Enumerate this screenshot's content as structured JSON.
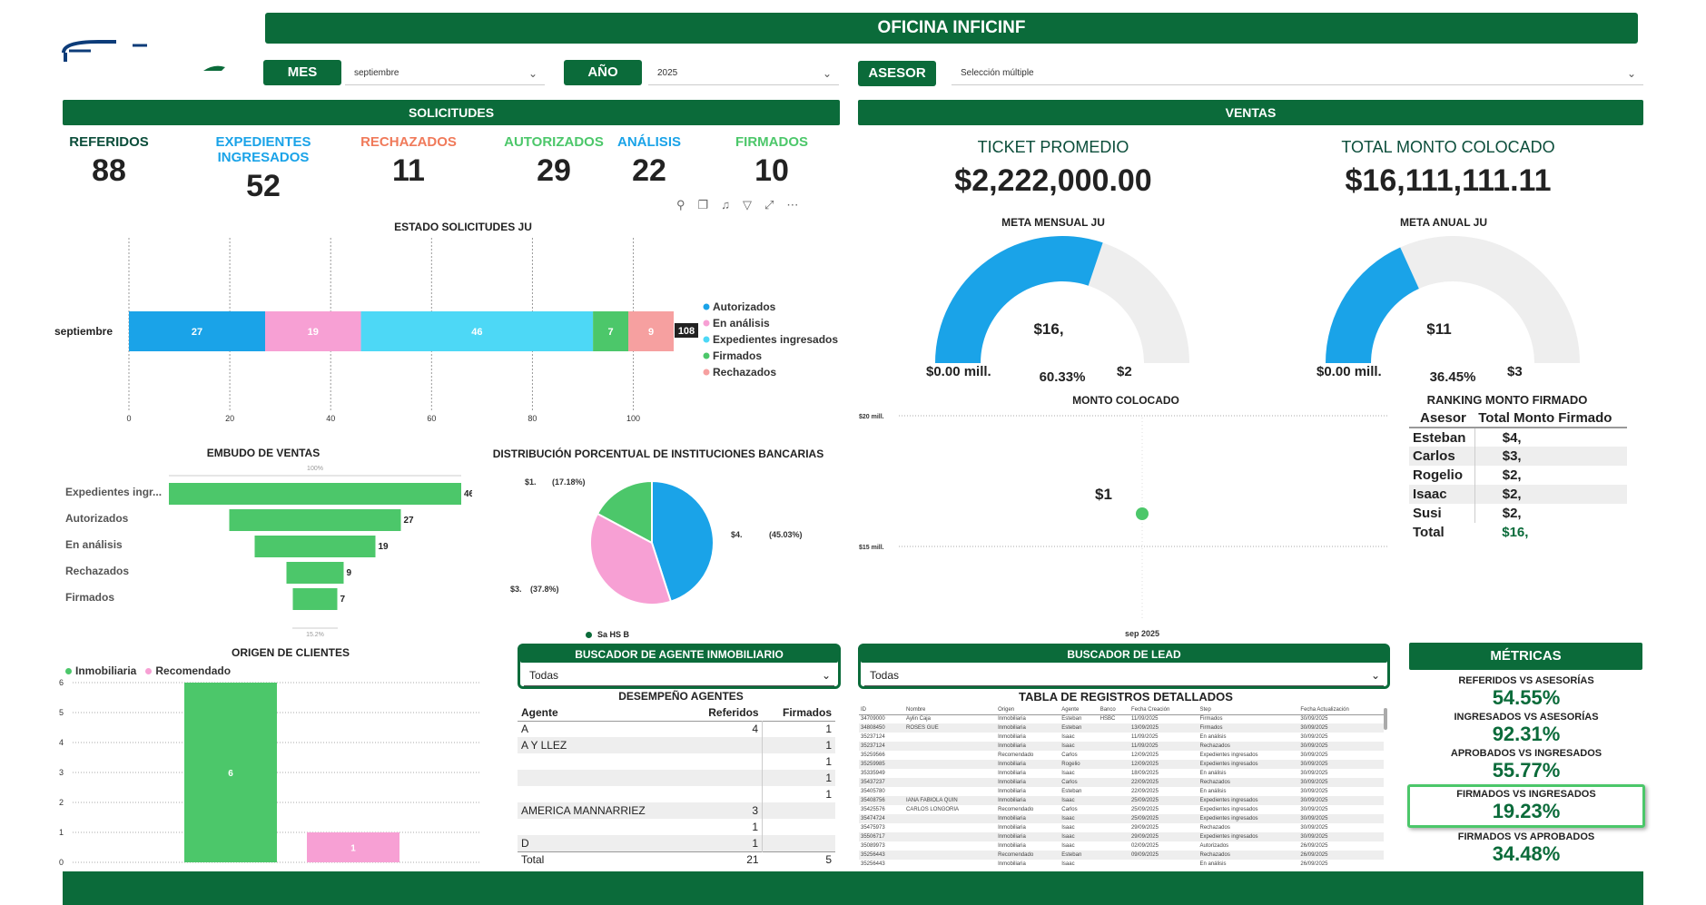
{
  "header": {
    "title": "OFICINA INFICINF"
  },
  "filters": {
    "mes_label": "MES",
    "mes_value": "septiembre",
    "anio_label": "AÑO",
    "anio_value": "2025",
    "asesor_label": "ASESOR",
    "asesor_value": "Selección múltiple"
  },
  "solicitudes": {
    "title": "SOLICITUDES",
    "kpis": [
      {
        "label": "REFERIDOS",
        "value": "88",
        "color": "#0b4d3a"
      },
      {
        "label": "EXPEDIENTES INGRESADOS",
        "value": "52",
        "color": "#1aa3e8"
      },
      {
        "label": "RECHAZADOS",
        "value": "11",
        "color": "#f07a5a"
      },
      {
        "label": "AUTORIZADOS",
        "value": "29",
        "color": "#4cc76a"
      },
      {
        "label": "ANÁLISIS",
        "value": "22",
        "color": "#1aa3e8"
      },
      {
        "label": "FIRMADOS",
        "value": "10",
        "color": "#4cc76a"
      }
    ]
  },
  "estado_chart": {
    "title": "ESTADO SOLICITUDES JU",
    "category": "septiembre",
    "total_label": "108",
    "legend": [
      "Autorizados",
      "En análisis",
      "Expedientes ingresados",
      "Firmados",
      "Rechazados"
    ]
  },
  "embudo": {
    "title": "EMBUDO DE VENTAS",
    "top_pct": "100%",
    "bottom_pct": "15.2%"
  },
  "distribucion": {
    "title": "DISTRIBUCIÓN PORCENTUAL DE INSTITUCIONES BANCARIAS",
    "legend_text": "Sa   HS   B"
  },
  "origen": {
    "title": "ORIGEN DE CLIENTES",
    "legend": [
      "Inmobiliaria",
      "Recomendado"
    ]
  },
  "buscador_agente": {
    "title": "BUSCADOR DE AGENTE INMOBILIARIO",
    "value": "Todas"
  },
  "desempeno": {
    "title": "DESEMPEÑO AGENTES",
    "headers": [
      "Agente",
      "Referidos",
      "Firmados"
    ],
    "rows": [
      {
        "agente": "A",
        "referidos": "4",
        "firmados": "1"
      },
      {
        "agente": "A  Y  LLEZ",
        "referidos": "",
        "firmados": "1"
      },
      {
        "agente": "",
        "referidos": "",
        "firmados": "1"
      },
      {
        "agente": "",
        "referidos": "",
        "firmados": "1"
      },
      {
        "agente": "",
        "referidos": "",
        "firmados": "1"
      },
      {
        "agente": "AMERICA MANNARRIEZ",
        "referidos": "3",
        "firmados": ""
      },
      {
        "agente": "",
        "referidos": "1",
        "firmados": ""
      },
      {
        "agente": "D",
        "referidos": "1",
        "firmados": ""
      }
    ],
    "total": {
      "agente": "Total",
      "referidos": "21",
      "firmados": "5"
    }
  },
  "ventas": {
    "title": "VENTAS",
    "ticket_label": "TICKET PROMEDIO",
    "ticket_value": "$2,222,000.00",
    "total_label": "TOTAL MONTO COLOCADO",
    "total_value": "$16,111,111.11",
    "meta_mensual": {
      "title": "META MENSUAL JU",
      "center": "$16,",
      "min": "$0.00 mill.",
      "pct": "60.33%",
      "max": "$2"
    },
    "meta_anual": {
      "title": "META ANUAL JU",
      "center": "$11",
      "min": "$0.00 mill.",
      "pct": "36.45%",
      "max": "$3"
    }
  },
  "monto_colocado": {
    "title": "MONTO COLOCADO",
    "y_top": "$20 mill.",
    "y_bottom": "$15 mill.",
    "point_label": "$1",
    "x_label": "sep 2025"
  },
  "ranking": {
    "title": "RANKING MONTO FIRMADO",
    "headers": [
      "Asesor",
      "Total Monto Firmado"
    ],
    "rows": [
      {
        "asesor": "Esteban",
        "monto": "$4,"
      },
      {
        "asesor": "Carlos",
        "monto": "$3,"
      },
      {
        "asesor": "Rogelio",
        "monto": "$2,"
      },
      {
        "asesor": "Isaac",
        "monto": "$2,"
      },
      {
        "asesor": "Susi",
        "monto": "$2,"
      }
    ],
    "total": {
      "asesor": "Total",
      "monto": "$16,"
    }
  },
  "buscador_lead": {
    "title": "BUSCADOR DE LEAD",
    "value": "Todas"
  },
  "tabla_registros": {
    "title": "TABLA DE REGISTROS DETALLADOS",
    "headers": [
      "ID",
      "Nombre",
      "Origen",
      "Agente",
      "Banco",
      "Fecha Creación",
      "Step",
      "Fecha Actualización"
    ],
    "rows": [
      [
        "34709000",
        "Aylin Caja",
        "Inmobiliaria",
        "Esteban",
        "HSBC",
        "11/09/2025",
        "Firmados",
        "30/09/2025"
      ],
      [
        "34808450",
        "ROSES GUE",
        "Inmobiliaria",
        "Esteban",
        "",
        "13/09/2025",
        "Firmados",
        "30/09/2025"
      ],
      [
        "35237124",
        "",
        "Inmobiliaria",
        "Isaac",
        "",
        "11/09/2025",
        "En análisis",
        "30/09/2025"
      ],
      [
        "35237124",
        "",
        "Inmobiliaria",
        "Isaac",
        "",
        "11/09/2025",
        "Rechazados",
        "30/09/2025"
      ],
      [
        "35259566",
        "",
        "Recomendado",
        "Carlos",
        "",
        "12/09/2025",
        "Expedientes ingresados",
        "30/09/2025"
      ],
      [
        "35259985",
        "",
        "Inmobiliaria",
        "Rogelio",
        "",
        "12/09/2025",
        "Expedientes ingresados",
        "30/09/2025"
      ],
      [
        "35335949",
        "",
        "Inmobiliaria",
        "Isaac",
        "",
        "18/09/2025",
        "En análisis",
        "30/09/2025"
      ],
      [
        "35437237",
        "",
        "Inmobiliaria",
        "Carlos",
        "",
        "22/09/2025",
        "Rechazados",
        "30/09/2025"
      ],
      [
        "35405780",
        "",
        "Inmobiliaria",
        "Esteban",
        "",
        "22/09/2025",
        "En análisis",
        "30/09/2025"
      ],
      [
        "35408756",
        "IANA FABIOLA QUIN",
        "Inmobiliaria",
        "Isaac",
        "",
        "25/09/2025",
        "Expedientes ingresados",
        "30/09/2025"
      ],
      [
        "35425576",
        "CARLOS LONGORIA",
        "Recomendado",
        "Carlos",
        "",
        "25/09/2025",
        "Expedientes ingresados",
        "30/09/2025"
      ],
      [
        "35474724",
        "",
        "Inmobiliaria",
        "Isaac",
        "",
        "25/09/2025",
        "Expedientes ingresados",
        "30/09/2025"
      ],
      [
        "35475973",
        "",
        "Inmobiliaria",
        "Isaac",
        "",
        "29/09/2025",
        "Rechazados",
        "30/09/2025"
      ],
      [
        "35506717",
        "",
        "Inmobiliaria",
        "Isaac",
        "",
        "29/09/2025",
        "Expedientes ingresados",
        "30/09/2025"
      ],
      [
        "35089973",
        "",
        "Inmobiliaria",
        "Isaac",
        "",
        "02/09/2025",
        "Autorizados",
        "26/09/2025"
      ],
      [
        "35256443",
        "",
        "Recomendado",
        "Esteban",
        "",
        "09/09/2025",
        "Rechazados",
        "26/09/2025"
      ],
      [
        "35256443",
        "",
        "Inmobiliaria",
        "Isaac",
        "",
        "",
        "En análisis",
        "26/09/2025"
      ]
    ]
  },
  "metricas": {
    "title": "MÉTRICAS",
    "items": [
      {
        "label": "REFERIDOS VS ASESORÍAS",
        "value": "54.55%"
      },
      {
        "label": "INGRESADOS VS ASESORÍAS",
        "value": "92.31%"
      },
      {
        "label": "APROBADOS VS INGRESADOS",
        "value": "55.77%"
      },
      {
        "label": "FIRMADOS VS INGRESADOS",
        "value": "19.23%"
      },
      {
        "label": "FIRMADOS VS APROBADOS",
        "value": "34.48%"
      }
    ]
  },
  "colors": {
    "brand_green": "#0b6b3a",
    "blue": "#1aa3e8",
    "pink": "#f7a0d4",
    "cyan": "#4dd8f6",
    "green": "#4cc76a",
    "salmon": "#f6a0a0"
  },
  "chart_data": [
    {
      "type": "bar",
      "title": "ESTADO SOLICITUDES JU",
      "categories": [
        "septiembre"
      ],
      "series": [
        {
          "name": "Autorizados",
          "values": [
            27
          ]
        },
        {
          "name": "En análisis",
          "values": [
            19
          ]
        },
        {
          "name": "Expedientes ingresados",
          "values": [
            46
          ]
        },
        {
          "name": "Firmados",
          "values": [
            7
          ]
        },
        {
          "name": "Rechazados",
          "values": [
            9
          ]
        }
      ],
      "xlim": [
        0,
        108
      ],
      "xticks": [
        0,
        20,
        40,
        60,
        80,
        100
      ],
      "total": 108,
      "stacked": true,
      "orientation": "horizontal",
      "legend": "right"
    },
    {
      "type": "bar",
      "title": "EMBUDO DE VENTAS",
      "categories": [
        "Expedientes ingr...",
        "Autorizados",
        "En análisis",
        "Rechazados",
        "Firmados"
      ],
      "values": [
        46,
        27,
        19,
        9,
        7
      ],
      "orientation": "funnel"
    },
    {
      "type": "pie",
      "title": "DISTRIBUCIÓN PORCENTUAL DE INSTITUCIONES BANCARIAS",
      "labels": [
        "$4.",
        "$3.",
        "$1."
      ],
      "values": [
        45.03,
        37.8,
        17.18
      ],
      "value_labels": [
        "(45.03%)",
        "(37.8%)",
        "(17.18%)"
      ]
    },
    {
      "type": "bar",
      "title": "ORIGEN DE CLIENTES",
      "categories": [
        "Inmobiliaria",
        "Recomendado"
      ],
      "values": [
        6,
        1
      ],
      "ylim": [
        0,
        6
      ],
      "yticks": [
        0,
        1,
        2,
        3,
        4,
        5,
        6
      ],
      "legend": "top-left"
    },
    {
      "type": "scatter",
      "title": "MONTO COLOCADO",
      "x": [
        "sep 2025"
      ],
      "ylim_labels": [
        "$15 mill.",
        "$20 mill."
      ]
    }
  ]
}
